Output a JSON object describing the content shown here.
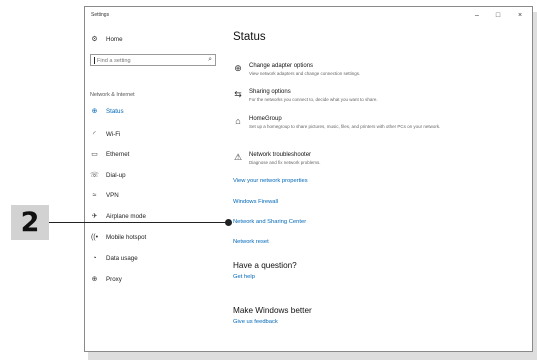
{
  "window": {
    "title": "Settings",
    "minimize": "–",
    "maximize": "□",
    "close": "×"
  },
  "sidebar": {
    "home": {
      "label": "Home",
      "icon": "home-gear-icon"
    },
    "search_placeholder": "Find a setting",
    "section": "Network & Internet",
    "items": [
      {
        "label": "Status",
        "icon": "globe-icon",
        "active": true
      },
      {
        "label": "Wi-Fi",
        "icon": "wifi-icon"
      },
      {
        "label": "Ethernet",
        "icon": "ethernet-icon"
      },
      {
        "label": "Dial-up",
        "icon": "dialup-icon"
      },
      {
        "label": "VPN",
        "icon": "vpn-icon"
      },
      {
        "label": "Airplane mode",
        "icon": "airplane-icon"
      },
      {
        "label": "Mobile hotspot",
        "icon": "hotspot-icon"
      },
      {
        "label": "Data usage",
        "icon": "data-usage-icon"
      },
      {
        "label": "Proxy",
        "icon": "proxy-globe-icon"
      }
    ]
  },
  "content": {
    "title": "Status",
    "cut_off_text": "",
    "options": [
      {
        "title": "Change adapter options",
        "desc": "View network adapters and change connection settings.",
        "icon": "adapter-icon"
      },
      {
        "title": "Sharing options",
        "desc": "For the networks you connect to, decide what you want to share.",
        "icon": "sharing-icon"
      },
      {
        "title": "HomeGroup",
        "desc": "Set up a homegroup to share pictures, music, files, and printers with other PCs on your network.",
        "icon": "homegroup-icon"
      },
      {
        "title": "Network troubleshooter",
        "desc": "Diagnose and fix network problems.",
        "icon": "warning-icon"
      }
    ],
    "links": [
      "View your network properties",
      "Windows Firewall",
      "Network and Sharing Center",
      "Network reset"
    ],
    "question": {
      "heading": "Have a question?",
      "link": "Get help"
    },
    "better": {
      "heading": "Make Windows better",
      "link": "Give us feedback"
    }
  },
  "callout": {
    "number": "2"
  },
  "colors": {
    "accent": "#0067b8",
    "callout_bg": "#d2d2d2"
  }
}
